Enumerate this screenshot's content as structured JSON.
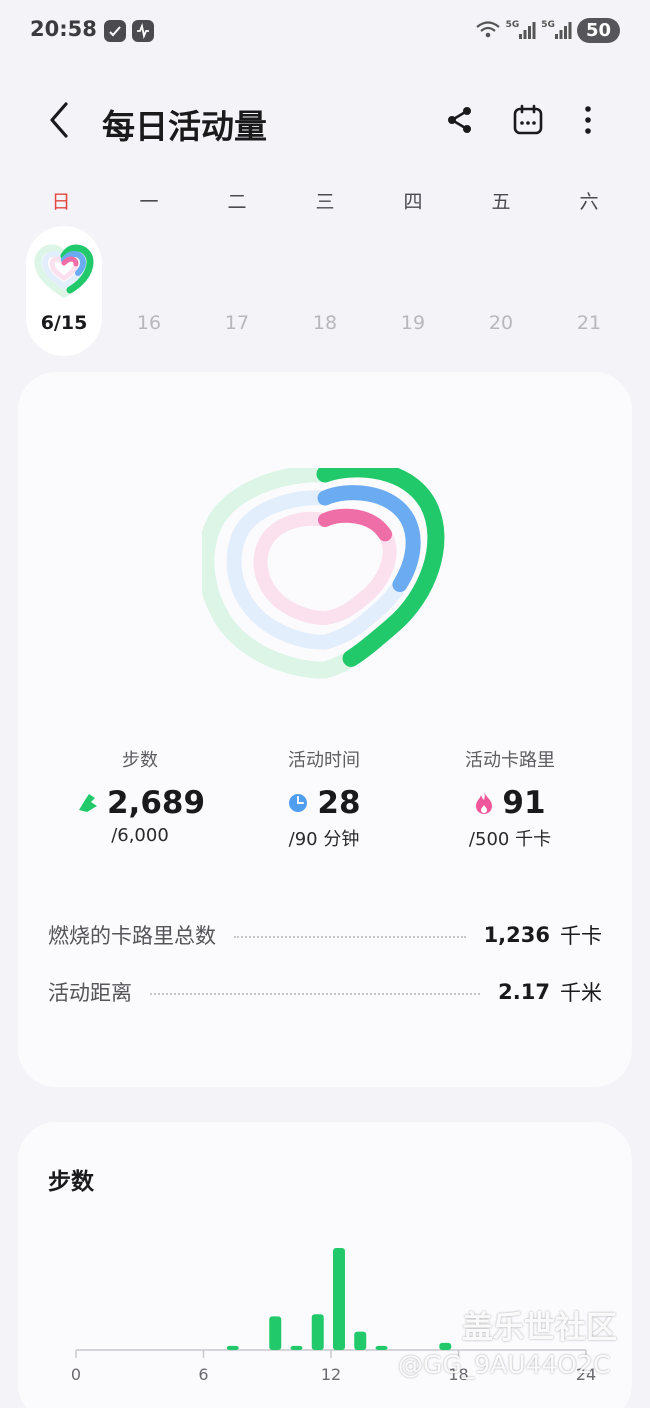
{
  "status_bar": {
    "time": "20:58",
    "signal_labels": [
      "5G",
      "5G"
    ],
    "battery": "50"
  },
  "header": {
    "title": "每日活动量",
    "back_icon": "chevron-left-icon",
    "actions": [
      "share-icon",
      "calendar-icon",
      "more-vertical-icon"
    ]
  },
  "week": {
    "weekdays": [
      "日",
      "一",
      "二",
      "三",
      "四",
      "五",
      "六"
    ],
    "dates": [
      "6/15",
      "16",
      "17",
      "18",
      "19",
      "20",
      "21"
    ],
    "selected_index": 0,
    "sunday_color": "#e2463e"
  },
  "summary": {
    "rings": {
      "steps_progress": 0.448,
      "active_time_progress": 0.311,
      "active_calories_progress": 0.182,
      "colors": {
        "steps": "#22c96a",
        "active_time": "#6aabf2",
        "active_calories": "#f06ea7"
      }
    },
    "stats": [
      {
        "label": "步数",
        "icon": "shoe-icon",
        "icon_color": "#22c96a",
        "value": "2,689",
        "goal": "/6,000"
      },
      {
        "label": "活动时间",
        "icon": "clock-icon",
        "icon_color": "#4f9ef0",
        "value": "28",
        "goal": "/90 分钟"
      },
      {
        "label": "活动卡路里",
        "icon": "flame-icon",
        "icon_color": "#f0569a",
        "value": "91",
        "goal": "/500 千卡"
      }
    ],
    "details": [
      {
        "label": "燃烧的卡路里总数",
        "value": "1,236",
        "unit": "千卡"
      },
      {
        "label": "活动距离",
        "value": "2.17",
        "unit": "千米"
      }
    ]
  },
  "steps_section": {
    "title": "步数",
    "chart_data": {
      "type": "bar",
      "x_ticks": [
        "0",
        "6",
        "12",
        "18",
        "24"
      ],
      "xlim": [
        0,
        24
      ],
      "bar_color": "#22c96a",
      "x": [
        7,
        9,
        10,
        11,
        12,
        13,
        14,
        17
      ],
      "values": [
        4,
        33,
        4,
        35,
        100,
        18,
        4,
        7
      ]
    }
  },
  "watermark": {
    "line1": "盖乐世社区",
    "line2": "@GG_9AU44O2C"
  }
}
